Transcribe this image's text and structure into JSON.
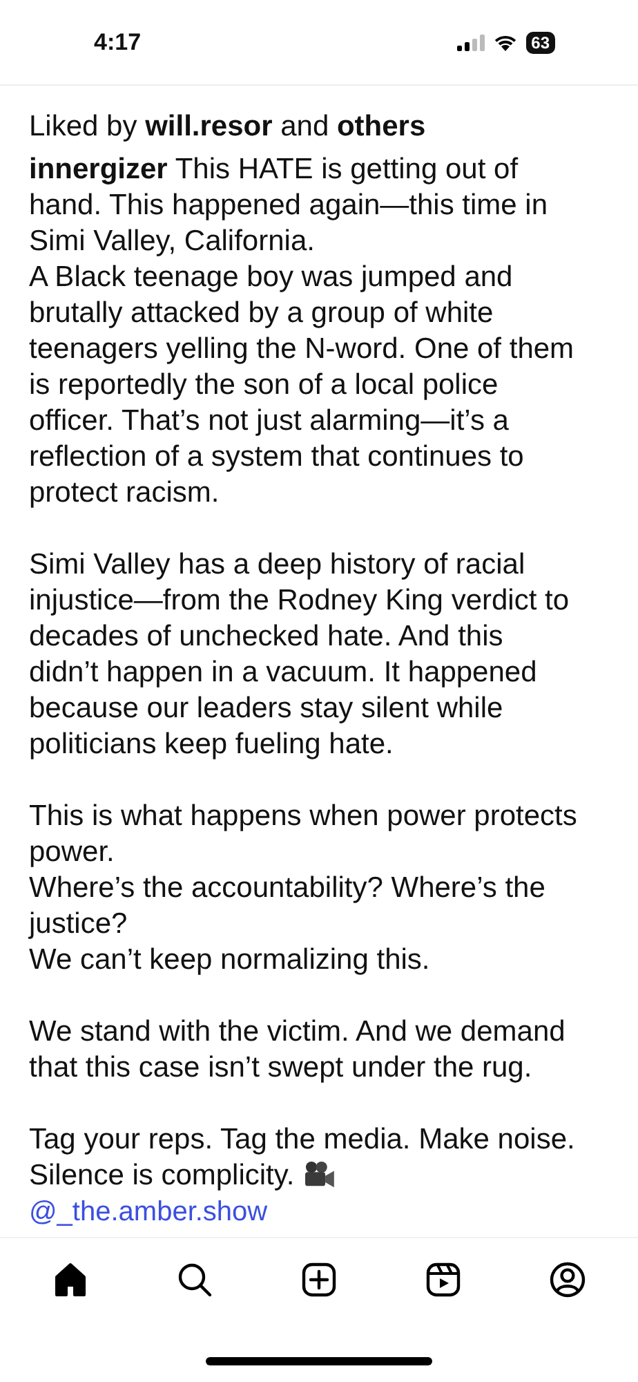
{
  "status_bar": {
    "time": "4:17",
    "battery": "63"
  },
  "likes": "Liked by **will.resor** and **others**",
  "caption": {
    "username": "innergizer",
    "blocks": [
      {
        "lines": [
          "This HATE is getting out of",
          "hand. This happened again—this time in",
          "Simi Valley, California.",
          "A Black teenage boy was jumped and",
          "brutally attacked by a group of white",
          "teenagers yelling the N-word. One of them",
          "is reportedly the son of a local police",
          "officer. That’s not just alarming—it’s a",
          "reflection of a system that continues to",
          "protect racism."
        ]
      },
      {
        "lines": [
          "Simi Valley has a deep history of racial",
          "injustice—from the Rodney King verdict to",
          "decades of unchecked hate. And this",
          "didn’t happen in a vacuum. It happened",
          "because our leaders stay silent while",
          "politicians keep fueling hate."
        ]
      },
      {
        "lines": [
          "This is what happens when power protects",
          "power.",
          "Where’s the accountability? Where’s the",
          "justice?",
          "We can’t keep normalizing this."
        ]
      },
      {
        "lines": [
          "We stand with the victim. And we demand",
          "that this case isn’t swept under the rug."
        ]
      },
      {
        "lines": [
          "Tag your reps. Tag the media. Make noise.",
          "Silence is complicity."
        ],
        "kind": "with-camera-icon"
      }
    ],
    "mention": "@_the.amber.show"
  },
  "nav": [
    {
      "kind": "home",
      "selected": true
    },
    {
      "kind": "search",
      "selected": false
    },
    {
      "kind": "create",
      "selected": false
    },
    {
      "kind": "reels",
      "selected": false
    },
    {
      "kind": "profile",
      "selected": false
    }
  ]
}
